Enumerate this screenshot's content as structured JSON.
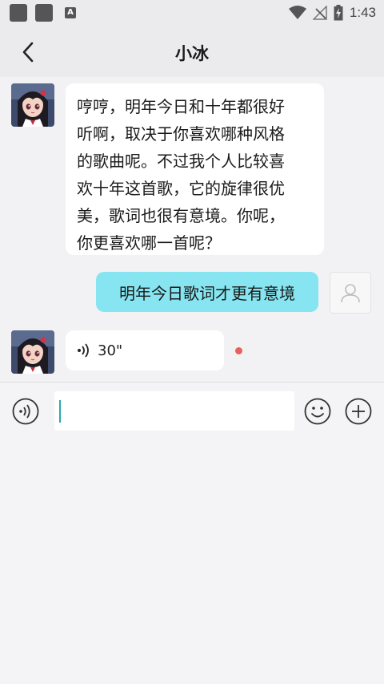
{
  "status_bar": {
    "time": "1:43",
    "font_badge": "A",
    "icons": [
      "notification-square-icon",
      "notification-square-icon",
      "font-icon",
      "wifi-icon",
      "no-signal-icon",
      "battery-charging-icon"
    ]
  },
  "header": {
    "title": "小冰",
    "back_icon": "back-arrow-icon"
  },
  "messages": [
    {
      "sender": "bot",
      "type": "text",
      "lines": [
        "哼哼，明年今日和十年都很好",
        "听啊，取决于你喜欢哪种风格",
        "的歌曲呢。不过我个人比较喜",
        "欢十年这首歌，它的旋律很优",
        "美，歌词也很有意境。你呢，",
        "你更喜欢哪一首呢？"
      ]
    },
    {
      "sender": "user",
      "type": "text",
      "text": "明年今日歌词才更有意境"
    },
    {
      "sender": "bot",
      "type": "voice",
      "duration": "30\""
    }
  ],
  "input_bar": {
    "value": "",
    "placeholder": "",
    "voice_icon": "voice-mode-icon",
    "emoji_icon": "emoji-icon",
    "plus_icon": "plus-icon"
  },
  "colors": {
    "user_bubble": "#86e5f0",
    "bot_bubble": "#ffffff",
    "background": "#f2f2f4",
    "unread_dot": "#e8605c",
    "caret": "#2aa6b3"
  }
}
